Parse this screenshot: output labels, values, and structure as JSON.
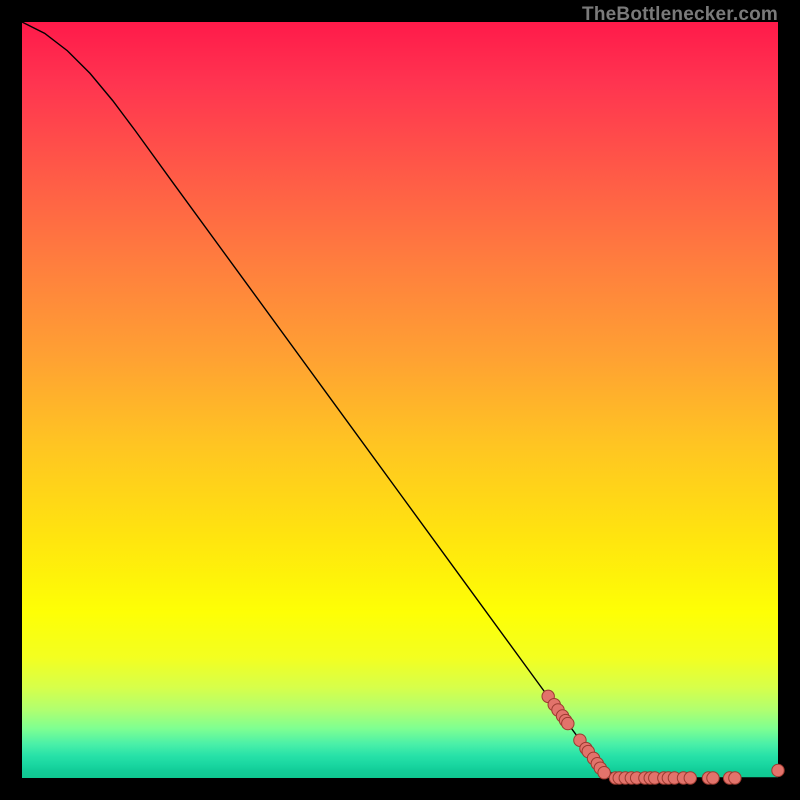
{
  "watermark": "TheBottlenecker.com",
  "chart_data": {
    "type": "line",
    "title": "",
    "xlabel": "",
    "ylabel": "",
    "xlim": [
      0,
      100
    ],
    "ylim": [
      0,
      100
    ],
    "curve": [
      {
        "x": 0.0,
        "y": 100.0
      },
      {
        "x": 3.0,
        "y": 98.5
      },
      {
        "x": 6.0,
        "y": 96.2
      },
      {
        "x": 9.0,
        "y": 93.2
      },
      {
        "x": 12.0,
        "y": 89.6
      },
      {
        "x": 15.0,
        "y": 85.6
      },
      {
        "x": 20.0,
        "y": 78.7
      },
      {
        "x": 30.0,
        "y": 65.0
      },
      {
        "x": 40.0,
        "y": 51.3
      },
      {
        "x": 50.0,
        "y": 37.6
      },
      {
        "x": 60.0,
        "y": 23.9
      },
      {
        "x": 70.0,
        "y": 10.2
      },
      {
        "x": 75.0,
        "y": 3.4
      },
      {
        "x": 78.0,
        "y": 0.6
      },
      {
        "x": 80.0,
        "y": 0.0
      },
      {
        "x": 100.0,
        "y": 0.0
      }
    ],
    "points": [
      {
        "x": 69.6,
        "y": 10.8
      },
      {
        "x": 70.4,
        "y": 9.7
      },
      {
        "x": 70.9,
        "y": 9.0
      },
      {
        "x": 71.5,
        "y": 8.2
      },
      {
        "x": 71.9,
        "y": 7.6
      },
      {
        "x": 72.2,
        "y": 7.2
      },
      {
        "x": 73.8,
        "y": 5.0
      },
      {
        "x": 74.6,
        "y": 3.9
      },
      {
        "x": 74.9,
        "y": 3.5
      },
      {
        "x": 75.6,
        "y": 2.6
      },
      {
        "x": 76.1,
        "y": 1.9
      },
      {
        "x": 76.5,
        "y": 1.3
      },
      {
        "x": 77.0,
        "y": 0.7
      },
      {
        "x": 78.5,
        "y": 0.0
      },
      {
        "x": 79.0,
        "y": 0.0
      },
      {
        "x": 79.8,
        "y": 0.0
      },
      {
        "x": 80.6,
        "y": 0.0
      },
      {
        "x": 81.3,
        "y": 0.0
      },
      {
        "x": 82.4,
        "y": 0.0
      },
      {
        "x": 83.1,
        "y": 0.0
      },
      {
        "x": 83.7,
        "y": 0.0
      },
      {
        "x": 84.9,
        "y": 0.0
      },
      {
        "x": 85.5,
        "y": 0.0
      },
      {
        "x": 86.3,
        "y": 0.0
      },
      {
        "x": 87.5,
        "y": 0.0
      },
      {
        "x": 88.4,
        "y": 0.0
      },
      {
        "x": 90.8,
        "y": 0.0
      },
      {
        "x": 91.4,
        "y": 0.0
      },
      {
        "x": 93.6,
        "y": 0.0
      },
      {
        "x": 94.3,
        "y": 0.0
      },
      {
        "x": 100.0,
        "y": 1.0
      }
    ],
    "colors": {
      "line": "#000000",
      "point_fill": "#e2736b",
      "point_stroke": "#9c3a30"
    }
  }
}
